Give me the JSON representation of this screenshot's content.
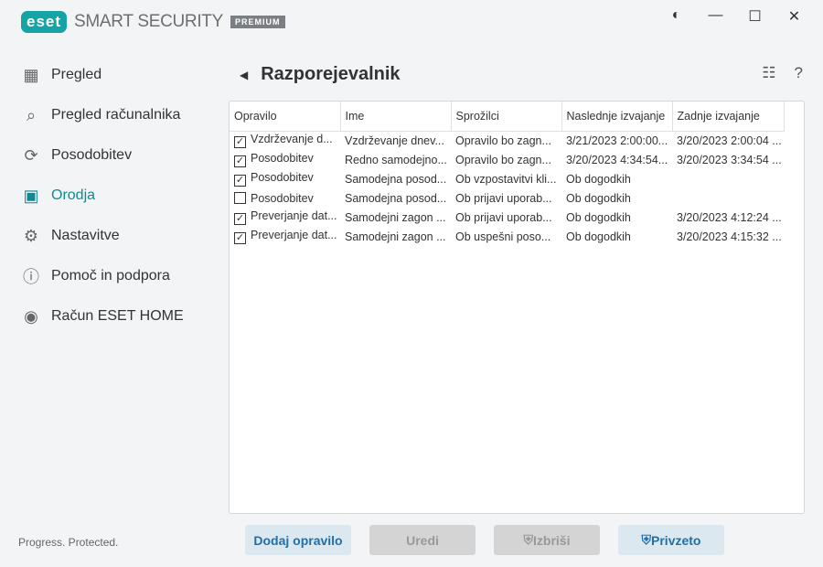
{
  "app": {
    "logo": "eset",
    "product": "SMART SECURITY",
    "edition": "PREMIUM",
    "tagline": "Progress. Protected."
  },
  "sidebar": {
    "items": [
      {
        "label": "Pregled",
        "icon": "dashboard-icon"
      },
      {
        "label": "Pregled računalnika",
        "icon": "search-icon"
      },
      {
        "label": "Posodobitev",
        "icon": "refresh-icon"
      },
      {
        "label": "Orodja",
        "icon": "briefcase-icon",
        "active": true
      },
      {
        "label": "Nastavitve",
        "icon": "gear-icon"
      },
      {
        "label": "Pomoč in podpora",
        "icon": "help-icon"
      },
      {
        "label": "Račun ESET HOME",
        "icon": "account-icon"
      }
    ]
  },
  "page": {
    "title": "Razporejevalnik"
  },
  "table": {
    "columns": [
      "Opravilo",
      "Ime",
      "Sprožilci",
      "Naslednje izvajanje",
      "Zadnje izvajanje"
    ],
    "rows": [
      {
        "checked": true,
        "cells": [
          "Vzdrževanje d...",
          "Vzdrževanje dnev...",
          "Opravilo bo zagn...",
          "3/21/2023 2:00:00...",
          "3/20/2023 2:00:04 ..."
        ]
      },
      {
        "checked": true,
        "cells": [
          "Posodobitev",
          "Redno samodejno...",
          "Opravilo bo zagn...",
          "3/20/2023 4:34:54...",
          "3/20/2023 3:34:54 ..."
        ]
      },
      {
        "checked": true,
        "cells": [
          "Posodobitev",
          "Samodejna posod...",
          "Ob vzpostavitvi kli...",
          "Ob dogodkih",
          ""
        ]
      },
      {
        "checked": false,
        "cells": [
          "Posodobitev",
          "Samodejna posod...",
          "Ob prijavi uporab...",
          "Ob dogodkih",
          ""
        ]
      },
      {
        "checked": true,
        "cells": [
          "Preverjanje dat...",
          "Samodejni zagon ...",
          "Ob prijavi uporab...",
          "Ob dogodkih",
          "3/20/2023 4:12:24 ..."
        ]
      },
      {
        "checked": true,
        "cells": [
          "Preverjanje dat...",
          "Samodejni zagon ...",
          "Ob uspešni poso...",
          "Ob dogodkih",
          "3/20/2023 4:15:32 ..."
        ]
      }
    ]
  },
  "buttons": {
    "add": "Dodaj opravilo",
    "edit": "Uredi",
    "delete": "Izbriši",
    "default": "Privzeto"
  },
  "colors": {
    "accent": "#0d8a96",
    "button_text": "#1f6fa8"
  }
}
